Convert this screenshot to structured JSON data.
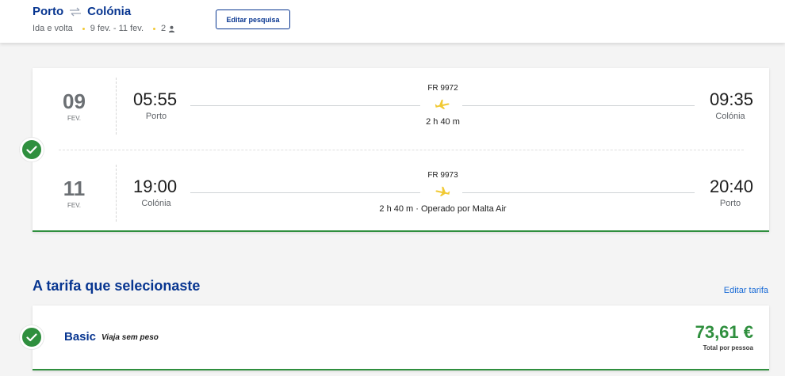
{
  "header": {
    "origin": "Porto",
    "destination": "Colónia",
    "trip_type": "Ida e volta",
    "dates": "9 fev. - 11 fev.",
    "passengers": "2",
    "edit_search_label": "Editar pesquisa"
  },
  "flights": [
    {
      "day": "09",
      "month": "FEV.",
      "dep_time": "05:55",
      "dep_city": "Porto",
      "arr_time": "09:35",
      "arr_city": "Colónia",
      "flight_number": "FR 9972",
      "duration": "2 h 40 m"
    },
    {
      "day": "11",
      "month": "FEV.",
      "dep_time": "19:00",
      "dep_city": "Colónia",
      "arr_time": "20:40",
      "arr_city": "Porto",
      "flight_number": "FR 9973",
      "duration": "2 h 40 m · Operado por Malta Air"
    }
  ],
  "fare": {
    "section_title": "A tarifa que selecionaste",
    "edit_fare_label": "Editar tarifa",
    "name": "Basic",
    "description": "Viaja sem peso",
    "price": "73,61 €",
    "price_note": "Total por pessoa"
  },
  "colors": {
    "brand": "#073590",
    "success": "#2f8f3e",
    "accent": "#f1c933"
  },
  "icons": {
    "route": "round-trip-arrows-icon",
    "passenger": "person-icon",
    "plane": "airplane-icon",
    "check": "check-icon"
  }
}
